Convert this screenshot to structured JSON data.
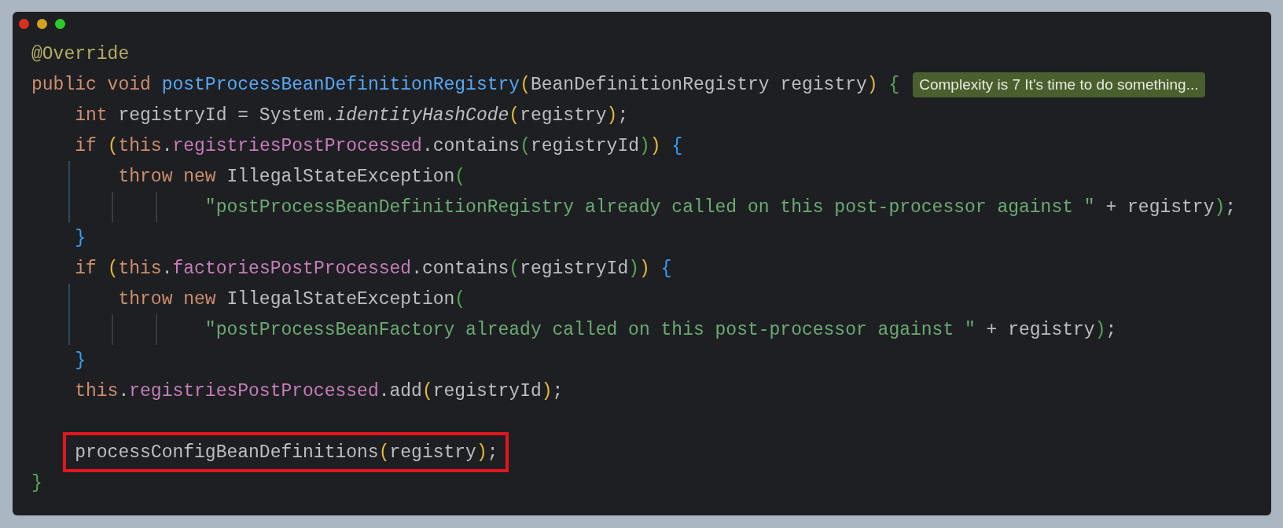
{
  "code_lines": [
    {
      "highlighted": false,
      "tokens": [
        {
          "kind": "annotation",
          "text": "@Override"
        }
      ]
    },
    {
      "highlighted": false,
      "tokens": [
        {
          "kind": "keyword",
          "text": "public void "
        },
        {
          "kind": "method",
          "text": "postProcessBeanDefinitionRegistry"
        },
        {
          "kind": "paren1",
          "text": "("
        },
        {
          "kind": "plain",
          "text": "BeanDefinitionRegistry registry"
        },
        {
          "kind": "paren1",
          "text": ")"
        },
        {
          "kind": "paren2",
          "text": " {"
        }
      ],
      "hint": "Complexity is 7 It's time to do something..."
    },
    {
      "highlighted": false,
      "tokens": [
        {
          "kind": "keyword",
          "text": "    int"
        },
        {
          "kind": "plain",
          "text": " registryId = System."
        },
        {
          "kind": "static-call",
          "text": "identityHashCode"
        },
        {
          "kind": "paren1",
          "text": "("
        },
        {
          "kind": "plain",
          "text": "registry"
        },
        {
          "kind": "paren1",
          "text": ")"
        },
        {
          "kind": "plain",
          "text": ";"
        }
      ]
    },
    {
      "highlighted": false,
      "tokens": [
        {
          "kind": "keyword",
          "text": "    if "
        },
        {
          "kind": "paren1",
          "text": "("
        },
        {
          "kind": "keyword",
          "text": "this"
        },
        {
          "kind": "plain",
          "text": "."
        },
        {
          "kind": "field",
          "text": "registriesPostProcessed"
        },
        {
          "kind": "plain",
          "text": ".contains"
        },
        {
          "kind": "paren2",
          "text": "("
        },
        {
          "kind": "plain",
          "text": "registryId"
        },
        {
          "kind": "paren2",
          "text": ")"
        },
        {
          "kind": "paren1",
          "text": ")"
        },
        {
          "kind": "paren3",
          "text": " {"
        }
      ]
    },
    {
      "highlighted": false,
      "tokens": [
        {
          "kind": "keyword",
          "text": "        throw new"
        },
        {
          "kind": "plain",
          "text": " IllegalStateException"
        },
        {
          "kind": "paren2",
          "text": "("
        }
      ]
    },
    {
      "highlighted": false,
      "tokens": [
        {
          "kind": "string",
          "text": "                \"postProcessBeanDefinitionRegistry already called on this post-processor against \""
        },
        {
          "kind": "plain",
          "text": " + registry"
        },
        {
          "kind": "paren2",
          "text": ")"
        },
        {
          "kind": "plain",
          "text": ";"
        }
      ]
    },
    {
      "highlighted": false,
      "tokens": [
        {
          "kind": "paren3",
          "text": "    }"
        }
      ]
    },
    {
      "highlighted": false,
      "tokens": [
        {
          "kind": "keyword",
          "text": "    if "
        },
        {
          "kind": "paren1",
          "text": "("
        },
        {
          "kind": "keyword",
          "text": "this"
        },
        {
          "kind": "plain",
          "text": "."
        },
        {
          "kind": "field",
          "text": "factoriesPostProcessed"
        },
        {
          "kind": "plain",
          "text": ".contains"
        },
        {
          "kind": "paren2",
          "text": "("
        },
        {
          "kind": "plain",
          "text": "registryId"
        },
        {
          "kind": "paren2",
          "text": ")"
        },
        {
          "kind": "paren1",
          "text": ")"
        },
        {
          "kind": "paren3",
          "text": " {"
        }
      ]
    },
    {
      "highlighted": false,
      "tokens": [
        {
          "kind": "keyword",
          "text": "        throw new"
        },
        {
          "kind": "plain",
          "text": " IllegalStateException"
        },
        {
          "kind": "paren2",
          "text": "("
        }
      ]
    },
    {
      "highlighted": false,
      "tokens": [
        {
          "kind": "string",
          "text": "                \"postProcessBeanFactory already called on this post-processor against \""
        },
        {
          "kind": "plain",
          "text": " + registry"
        },
        {
          "kind": "paren2",
          "text": ")"
        },
        {
          "kind": "plain",
          "text": ";"
        }
      ]
    },
    {
      "highlighted": false,
      "tokens": [
        {
          "kind": "paren3",
          "text": "    }"
        }
      ]
    },
    {
      "highlighted": false,
      "tokens": [
        {
          "kind": "keyword",
          "text": "    this"
        },
        {
          "kind": "plain",
          "text": "."
        },
        {
          "kind": "field",
          "text": "registriesPostProcessed"
        },
        {
          "kind": "plain",
          "text": ".add"
        },
        {
          "kind": "paren1",
          "text": "("
        },
        {
          "kind": "plain",
          "text": "registryId"
        },
        {
          "kind": "paren1",
          "text": ")"
        },
        {
          "kind": "plain",
          "text": ";"
        }
      ]
    },
    {
      "highlighted": false
    },
    {
      "highlighted": true,
      "tokens": [
        {
          "kind": "plain",
          "text": "    processConfigBeanDefinitions"
        },
        {
          "kind": "paren1",
          "text": "("
        },
        {
          "kind": "plain",
          "text": "registry"
        },
        {
          "kind": "paren1",
          "text": ")"
        },
        {
          "kind": "plain",
          "text": ";"
        }
      ]
    },
    {
      "highlighted": false,
      "tokens": [
        {
          "kind": "paren2",
          "text": "}"
        }
      ]
    }
  ]
}
